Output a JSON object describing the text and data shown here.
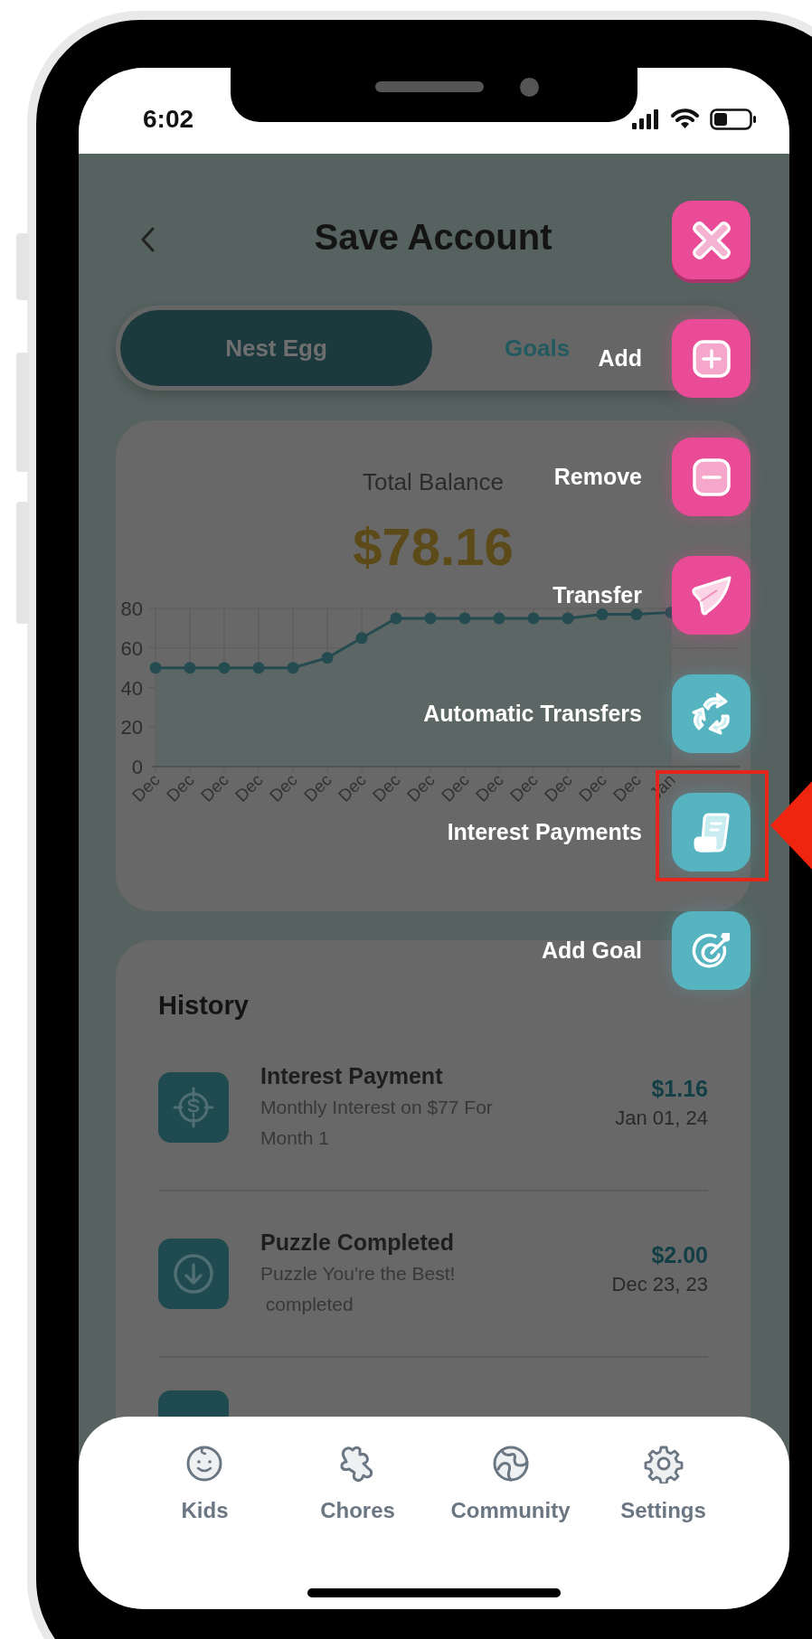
{
  "status_bar": {
    "time": "6:02"
  },
  "header": {
    "title": "Save Account"
  },
  "tabs": [
    {
      "label": "Nest Egg",
      "selected": true
    },
    {
      "label": "Goals",
      "selected": false
    }
  ],
  "balance": {
    "label": "Total Balance",
    "amount": "$78.16",
    "chart_data": {
      "type": "line",
      "categories": [
        "Dec",
        "Dec",
        "Dec",
        "Dec",
        "Dec",
        "Dec",
        "Dec",
        "Dec",
        "Dec",
        "Dec",
        "Dec",
        "Dec",
        "Dec",
        "Dec",
        "Dec",
        "Jan"
      ],
      "grid": true,
      "series": [
        {
          "color": "#234b50",
          "marker": "circle",
          "values": [
            50,
            50,
            50,
            50,
            50,
            55,
            65,
            75,
            75,
            75,
            75,
            75,
            75,
            77,
            77,
            78
          ]
        }
      ],
      "ylim": [
        0,
        80
      ],
      "yticks": [
        0,
        20,
        40,
        60,
        80
      ]
    }
  },
  "history": {
    "title": "History",
    "items": [
      {
        "kind": "interest",
        "title": "Interest Payment",
        "description": "Monthly Interest on $77 For Month 1",
        "amount": "$1.16",
        "date": "Jan 01, 24"
      },
      {
        "kind": "deposit",
        "title": "Puzzle Completed",
        "description": "Puzzle You're the Best!\n completed",
        "amount": "$2.00",
        "date": "Dec 23, 23"
      }
    ]
  },
  "action_menu": {
    "items": [
      {
        "kind": "add",
        "label": "Add",
        "color": "#e94b97"
      },
      {
        "kind": "remove",
        "label": "Remove",
        "color": "#e94b97"
      },
      {
        "kind": "transfer",
        "label": "Transfer",
        "color": "#e94b97"
      },
      {
        "kind": "auto_transfer",
        "label": "Automatic Transfers",
        "color": "#55b4c0"
      },
      {
        "kind": "interest",
        "label": "Interest Payments",
        "color": "#55b4c0"
      },
      {
        "kind": "goal",
        "label": "Add Goal",
        "color": "#55b4c0"
      }
    ]
  },
  "nav": [
    {
      "kind": "kids",
      "label": "Kids"
    },
    {
      "kind": "chores",
      "label": "Chores"
    },
    {
      "kind": "community",
      "label": "Community"
    },
    {
      "kind": "settings",
      "label": "Settings"
    }
  ]
}
